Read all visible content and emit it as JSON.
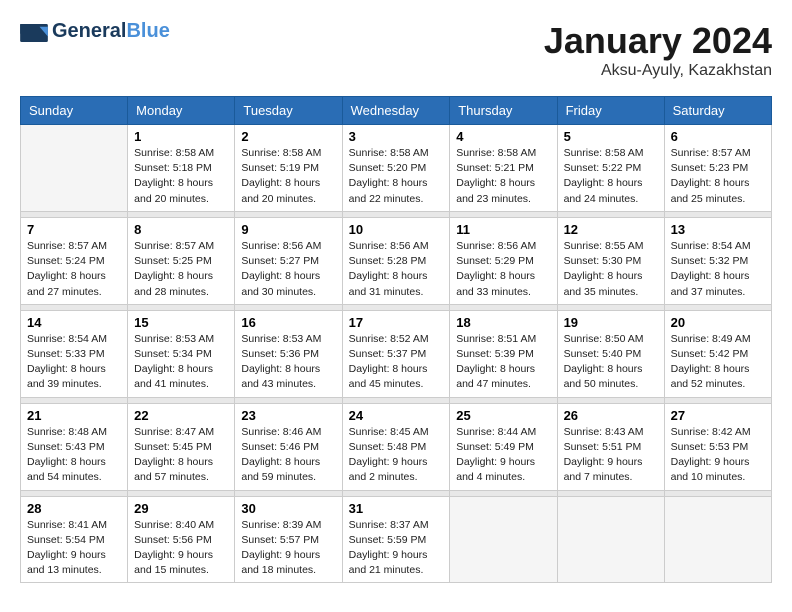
{
  "header": {
    "logo_general": "General",
    "logo_blue": "Blue",
    "month_title": "January 2024",
    "location": "Aksu-Ayuly, Kazakhstan"
  },
  "weekdays": [
    "Sunday",
    "Monday",
    "Tuesday",
    "Wednesday",
    "Thursday",
    "Friday",
    "Saturday"
  ],
  "weeks": [
    [
      {
        "day": "",
        "info": ""
      },
      {
        "day": "1",
        "info": "Sunrise: 8:58 AM\nSunset: 5:18 PM\nDaylight: 8 hours\nand 20 minutes."
      },
      {
        "day": "2",
        "info": "Sunrise: 8:58 AM\nSunset: 5:19 PM\nDaylight: 8 hours\nand 20 minutes."
      },
      {
        "day": "3",
        "info": "Sunrise: 8:58 AM\nSunset: 5:20 PM\nDaylight: 8 hours\nand 22 minutes."
      },
      {
        "day": "4",
        "info": "Sunrise: 8:58 AM\nSunset: 5:21 PM\nDaylight: 8 hours\nand 23 minutes."
      },
      {
        "day": "5",
        "info": "Sunrise: 8:58 AM\nSunset: 5:22 PM\nDaylight: 8 hours\nand 24 minutes."
      },
      {
        "day": "6",
        "info": "Sunrise: 8:57 AM\nSunset: 5:23 PM\nDaylight: 8 hours\nand 25 minutes."
      }
    ],
    [
      {
        "day": "7",
        "info": "Sunrise: 8:57 AM\nSunset: 5:24 PM\nDaylight: 8 hours\nand 27 minutes."
      },
      {
        "day": "8",
        "info": "Sunrise: 8:57 AM\nSunset: 5:25 PM\nDaylight: 8 hours\nand 28 minutes."
      },
      {
        "day": "9",
        "info": "Sunrise: 8:56 AM\nSunset: 5:27 PM\nDaylight: 8 hours\nand 30 minutes."
      },
      {
        "day": "10",
        "info": "Sunrise: 8:56 AM\nSunset: 5:28 PM\nDaylight: 8 hours\nand 31 minutes."
      },
      {
        "day": "11",
        "info": "Sunrise: 8:56 AM\nSunset: 5:29 PM\nDaylight: 8 hours\nand 33 minutes."
      },
      {
        "day": "12",
        "info": "Sunrise: 8:55 AM\nSunset: 5:30 PM\nDaylight: 8 hours\nand 35 minutes."
      },
      {
        "day": "13",
        "info": "Sunrise: 8:54 AM\nSunset: 5:32 PM\nDaylight: 8 hours\nand 37 minutes."
      }
    ],
    [
      {
        "day": "14",
        "info": "Sunrise: 8:54 AM\nSunset: 5:33 PM\nDaylight: 8 hours\nand 39 minutes."
      },
      {
        "day": "15",
        "info": "Sunrise: 8:53 AM\nSunset: 5:34 PM\nDaylight: 8 hours\nand 41 minutes."
      },
      {
        "day": "16",
        "info": "Sunrise: 8:53 AM\nSunset: 5:36 PM\nDaylight: 8 hours\nand 43 minutes."
      },
      {
        "day": "17",
        "info": "Sunrise: 8:52 AM\nSunset: 5:37 PM\nDaylight: 8 hours\nand 45 minutes."
      },
      {
        "day": "18",
        "info": "Sunrise: 8:51 AM\nSunset: 5:39 PM\nDaylight: 8 hours\nand 47 minutes."
      },
      {
        "day": "19",
        "info": "Sunrise: 8:50 AM\nSunset: 5:40 PM\nDaylight: 8 hours\nand 50 minutes."
      },
      {
        "day": "20",
        "info": "Sunrise: 8:49 AM\nSunset: 5:42 PM\nDaylight: 8 hours\nand 52 minutes."
      }
    ],
    [
      {
        "day": "21",
        "info": "Sunrise: 8:48 AM\nSunset: 5:43 PM\nDaylight: 8 hours\nand 54 minutes."
      },
      {
        "day": "22",
        "info": "Sunrise: 8:47 AM\nSunset: 5:45 PM\nDaylight: 8 hours\nand 57 minutes."
      },
      {
        "day": "23",
        "info": "Sunrise: 8:46 AM\nSunset: 5:46 PM\nDaylight: 8 hours\nand 59 minutes."
      },
      {
        "day": "24",
        "info": "Sunrise: 8:45 AM\nSunset: 5:48 PM\nDaylight: 9 hours\nand 2 minutes."
      },
      {
        "day": "25",
        "info": "Sunrise: 8:44 AM\nSunset: 5:49 PM\nDaylight: 9 hours\nand 4 minutes."
      },
      {
        "day": "26",
        "info": "Sunrise: 8:43 AM\nSunset: 5:51 PM\nDaylight: 9 hours\nand 7 minutes."
      },
      {
        "day": "27",
        "info": "Sunrise: 8:42 AM\nSunset: 5:53 PM\nDaylight: 9 hours\nand 10 minutes."
      }
    ],
    [
      {
        "day": "28",
        "info": "Sunrise: 8:41 AM\nSunset: 5:54 PM\nDaylight: 9 hours\nand 13 minutes."
      },
      {
        "day": "29",
        "info": "Sunrise: 8:40 AM\nSunset: 5:56 PM\nDaylight: 9 hours\nand 15 minutes."
      },
      {
        "day": "30",
        "info": "Sunrise: 8:39 AM\nSunset: 5:57 PM\nDaylight: 9 hours\nand 18 minutes."
      },
      {
        "day": "31",
        "info": "Sunrise: 8:37 AM\nSunset: 5:59 PM\nDaylight: 9 hours\nand 21 minutes."
      },
      {
        "day": "",
        "info": ""
      },
      {
        "day": "",
        "info": ""
      },
      {
        "day": "",
        "info": ""
      }
    ]
  ]
}
